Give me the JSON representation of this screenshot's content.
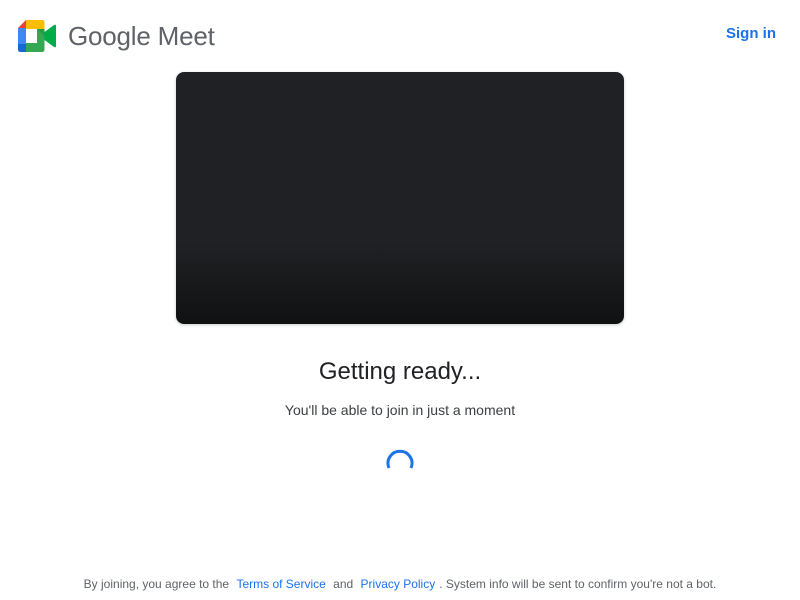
{
  "header": {
    "brand_name": "Google Meet",
    "logo_icon": "google-meet-logo-icon",
    "sign_in_label": "Sign in"
  },
  "status": {
    "title": "Getting ready...",
    "subtitle": "You'll be able to join in just a moment",
    "spinner_icon": "loading-spinner-icon"
  },
  "footer": {
    "prefix": "By joining, you agree to the",
    "terms_label": "Terms of Service",
    "conjunction": "and",
    "privacy_label": "Privacy Policy",
    "suffix": ". System info will be sent to confirm you're not a bot."
  },
  "colors": {
    "accent": "#1a73e8",
    "preview_bg": "#202124",
    "brand_text": "#5f6368"
  }
}
